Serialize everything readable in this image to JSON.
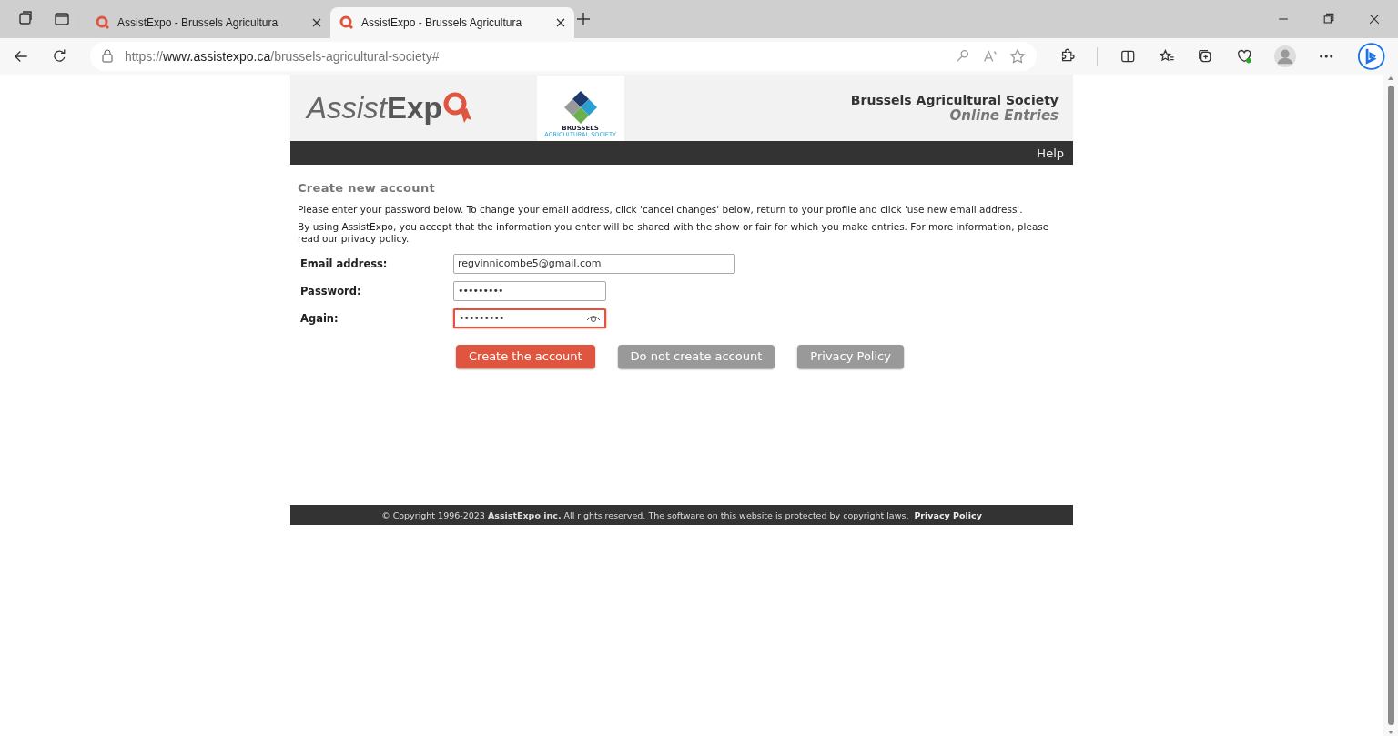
{
  "browser": {
    "tabs": [
      {
        "title": "AssistExpo - Brussels Agricultura",
        "selected": false
      },
      {
        "title": "AssistExpo - Brussels Agricultura",
        "selected": true
      }
    ],
    "url": {
      "scheme": "https://",
      "host": "www.assistexpo.ca",
      "path": "/brussels-agricultural-society#"
    }
  },
  "header": {
    "logo_light": "Assist",
    "logo_bold": "Exp",
    "partner_logo": {
      "name": "BRUSSELS",
      "subtitle": "AGRICULTURAL SOCIETY"
    },
    "org_name": "Brussels Agricultural Society",
    "subtitle": "Online Entries",
    "nav": [
      "Help"
    ]
  },
  "form": {
    "heading": "Create new account",
    "paragraphs": [
      "Please enter your password below. To change your email address, click 'cancel changes' below, return to your profile and click 'use new email address'.",
      "By using AssistExpo, you accept that the information you enter will be shared with the show or fair for which you make entries. For more information, please read our privacy policy."
    ],
    "fields": [
      {
        "label": "Email address:",
        "kind": "email",
        "value": "regvinnicombe5@gmail.com",
        "focused": false
      },
      {
        "label": "Password:",
        "kind": "password",
        "value": "•••••••••",
        "focused": false
      },
      {
        "label": "Again:",
        "kind": "password",
        "value": "•••••••••",
        "focused": true
      }
    ],
    "buttons": [
      {
        "label": "Create the account",
        "kind": "primary"
      },
      {
        "label": "Do not create account",
        "kind": "secondary"
      },
      {
        "label": "Privacy Policy",
        "kind": "secondary"
      }
    ]
  },
  "footer": {
    "text": "© Copyright 1996-2023 **AssistExpo inc.**  All rights reserved.  The software on this website is protected by copyright laws.",
    "link": "Privacy Policy"
  }
}
